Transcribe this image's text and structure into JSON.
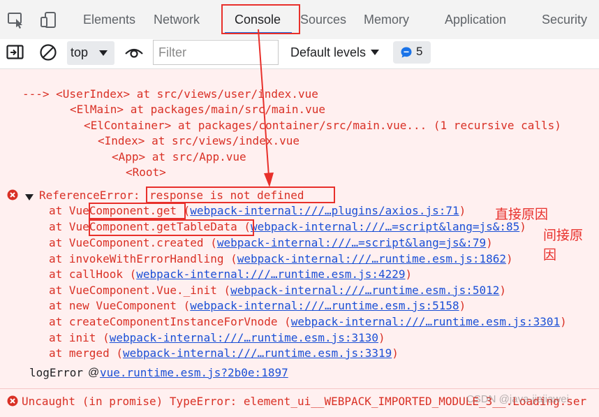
{
  "tabs": {
    "elements": "Elements",
    "network": "Network",
    "console": "Console",
    "sources": "Sources",
    "memory": "Memory",
    "application": "Application",
    "security": "Security"
  },
  "toolbar": {
    "context": "top",
    "filter_placeholder": "Filter",
    "levels": "Default levels",
    "issues_count": "5"
  },
  "console": {
    "trace_lines": [
      "---> <UserIndex> at src/views/user/index.vue",
      "<ElMain> at packages/main/src/main.vue",
      "<ElContainer> at packages/container/src/main.vue... (1 recursive calls)",
      "<Index> at src/views/index.vue",
      "<App> at src/App.vue",
      "<Root>"
    ],
    "error": {
      "type": "ReferenceError:",
      "message": "response is not defined",
      "frames": [
        {
          "fn": "at VueComponent.get",
          "link": "webpack-internal:///…plugins/axios.js:71"
        },
        {
          "fn": "at VueComponent.getTableData",
          "link": "webpack-internal:///…=script&lang=js&:85"
        },
        {
          "fn": "at VueComponent.created",
          "link": "webpack-internal:///…=script&lang=js&:79"
        },
        {
          "fn": "at invokeWithErrorHandling",
          "link": "webpack-internal:///…runtime.esm.js:1862"
        },
        {
          "fn": "at callHook",
          "link": "webpack-internal:///…runtime.esm.js:4229"
        },
        {
          "fn": "at VueComponent.Vue._init",
          "link": "webpack-internal:///…runtime.esm.js:5012"
        },
        {
          "fn": "at new VueComponent",
          "link": "webpack-internal:///…runtime.esm.js:5158"
        },
        {
          "fn": "at createComponentInstanceForVnode",
          "link": "webpack-internal:///…runtime.esm.js:3301"
        },
        {
          "fn": "at init",
          "link": "webpack-internal:///…runtime.esm.js:3130"
        },
        {
          "fn": "at merged",
          "link": "webpack-internal:///…runtime.esm.js:3319"
        }
      ],
      "log_error": "logError",
      "log_error_at": "@",
      "log_error_link": "vue.runtime.esm.js?2b0e:1897"
    },
    "uncaught": "Uncaught (in promise) TypeError: element_ui__WEBPACK_IMPORTED_MODULE_3__.Loading.ser"
  },
  "annotations": {
    "direct_cause": "直接原因",
    "indirect_cause_1": "间接原",
    "indirect_cause_2": "因"
  },
  "watermark": "CSDN @java-jiajiawei",
  "colors": {
    "error_text": "#d93025",
    "error_bg": "#fff0f0",
    "link": "#1a4fd6",
    "annotation_red": "#e8302b",
    "console_underline": "#1a73e8"
  }
}
